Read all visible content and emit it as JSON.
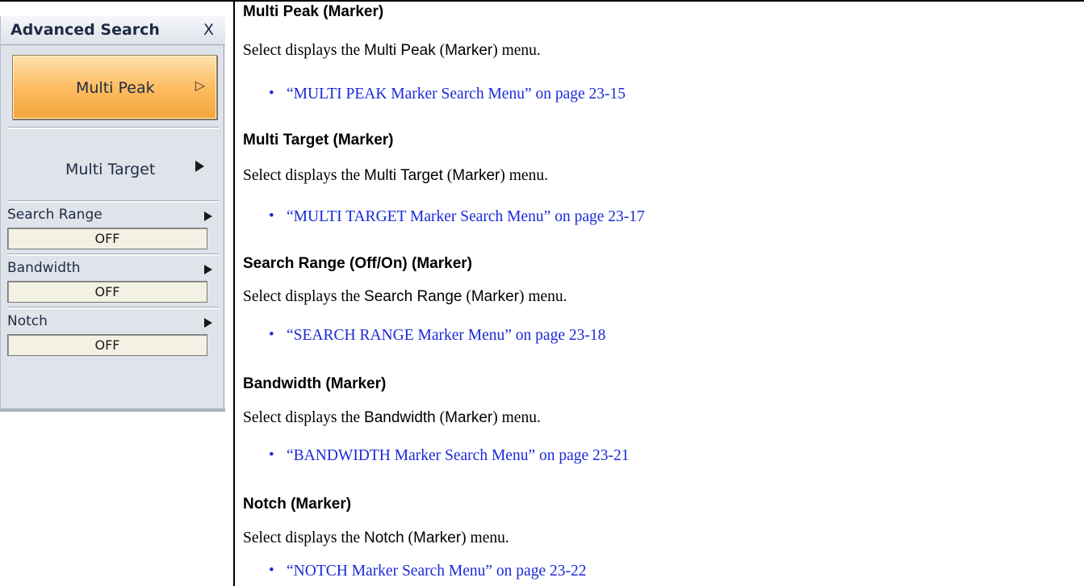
{
  "menu": {
    "title": "Advanced Search",
    "close_label": "X",
    "multi_peak_label": "Multi Peak",
    "multi_peak_arrow": "▷",
    "multi_target_label": "Multi Target",
    "params": [
      {
        "label": "Search Range",
        "value": "OFF"
      },
      {
        "label": "Bandwidth",
        "value": "OFF"
      },
      {
        "label": "Notch",
        "value": "OFF"
      }
    ]
  },
  "entries": [
    {
      "heading": "Multi Peak (Marker)",
      "lead": "Select displays the ",
      "ui": "Multi Peak",
      "mid": " (",
      "ui2": "Marker",
      "tail": ") menu.",
      "link": "“MULTI PEAK Marker Search Menu” on page 23-15"
    },
    {
      "heading": "Multi Target (Marker)",
      "lead": "Select displays the ",
      "ui": "Multi Target",
      "mid": " (",
      "ui2": "Marker",
      "tail": ") menu.",
      "link": "“MULTI TARGET Marker Search Menu” on page 23-17"
    },
    {
      "heading": "Search Range (Off/On) (Marker)",
      "lead": "Select displays the ",
      "ui": "Search Range",
      "mid": " (",
      "ui2": "Marker",
      "tail": ") menu.",
      "link": "“SEARCH RANGE Marker Menu” on page 23-18"
    },
    {
      "heading": "Bandwidth (Marker)",
      "lead": "Select displays the ",
      "ui": "Bandwidth",
      "mid": " (",
      "ui2": "Marker",
      "tail": ") menu.",
      "link": "“BANDWIDTH Marker Search Menu” on page 23-21"
    },
    {
      "heading": "Notch (Marker)",
      "lead": "Select displays the ",
      "ui": "Notch",
      "mid": " (",
      "ui2": "Marker",
      "tail": ") menu.",
      "link": "“NOTCH Marker Search Menu” on page 23-22"
    }
  ],
  "bullet_glyph": "•"
}
